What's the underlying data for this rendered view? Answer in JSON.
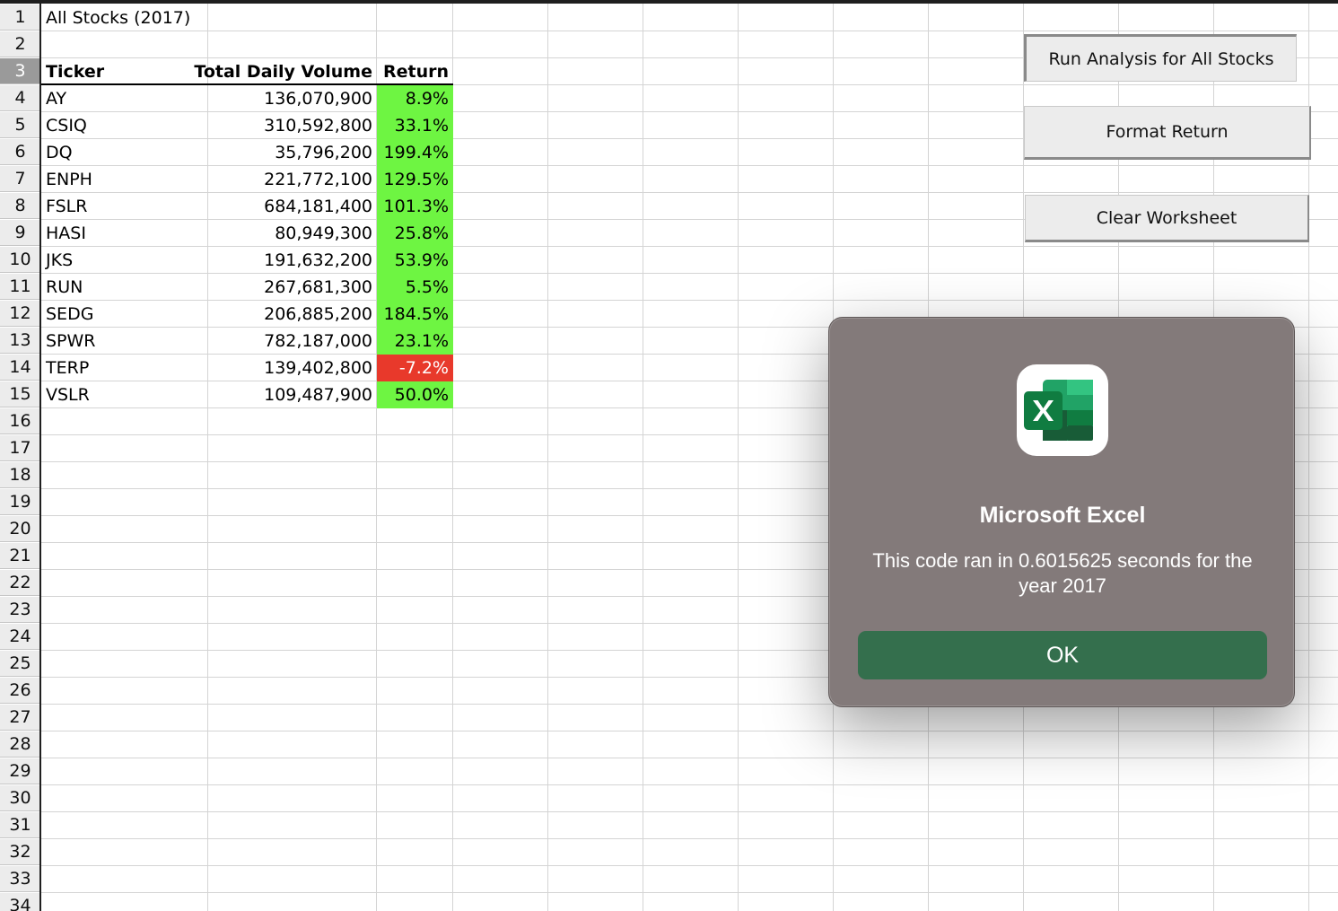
{
  "sheet": {
    "row_numbers": [
      "1",
      "2",
      "3",
      "4",
      "5",
      "6",
      "7",
      "8",
      "9",
      "10",
      "11",
      "12",
      "13",
      "14",
      "15",
      "16",
      "17",
      "18",
      "19",
      "20",
      "21",
      "22",
      "23",
      "24",
      "25",
      "26",
      "27",
      "28",
      "29",
      "30",
      "31",
      "32",
      "33",
      "34"
    ],
    "selected_row": "3",
    "title": "All Stocks (2017)",
    "headers": {
      "ticker": "Ticker",
      "volume": "Total Daily Volume",
      "return": "Return"
    },
    "rows": [
      {
        "ticker": "AY",
        "volume": "136,070,900",
        "return": "8.9%",
        "status": "positive"
      },
      {
        "ticker": "CSIQ",
        "volume": "310,592,800",
        "return": "33.1%",
        "status": "positive"
      },
      {
        "ticker": "DQ",
        "volume": "35,796,200",
        "return": "199.4%",
        "status": "positive"
      },
      {
        "ticker": "ENPH",
        "volume": "221,772,100",
        "return": "129.5%",
        "status": "positive"
      },
      {
        "ticker": "FSLR",
        "volume": "684,181,400",
        "return": "101.3%",
        "status": "positive"
      },
      {
        "ticker": "HASI",
        "volume": "80,949,300",
        "return": "25.8%",
        "status": "positive"
      },
      {
        "ticker": "JKS",
        "volume": "191,632,200",
        "return": "53.9%",
        "status": "positive"
      },
      {
        "ticker": "RUN",
        "volume": "267,681,300",
        "return": "5.5%",
        "status": "positive"
      },
      {
        "ticker": "SEDG",
        "volume": "206,885,200",
        "return": "184.5%",
        "status": "positive"
      },
      {
        "ticker": "SPWR",
        "volume": "782,187,000",
        "return": "23.1%",
        "status": "positive"
      },
      {
        "ticker": "TERP",
        "volume": "139,402,800",
        "return": "-7.2%",
        "status": "negative"
      },
      {
        "ticker": "VSLR",
        "volume": "109,487,900",
        "return": "50.0%",
        "status": "positive"
      }
    ]
  },
  "buttons": {
    "run_analysis": "Run Analysis for All Stocks",
    "format_return": "Format Return",
    "clear_worksheet": "Clear Worksheet"
  },
  "dialog": {
    "app_icon": "excel-app-icon",
    "title": "Microsoft Excel",
    "message": "This code ran in 0.6015625 seconds for the year 2017",
    "ok_label": "OK"
  },
  "colors": {
    "positive": "#6ef542",
    "negative": "#e8392b",
    "excel_green": "#346f4d",
    "dialog_bg": "#837a7a"
  }
}
